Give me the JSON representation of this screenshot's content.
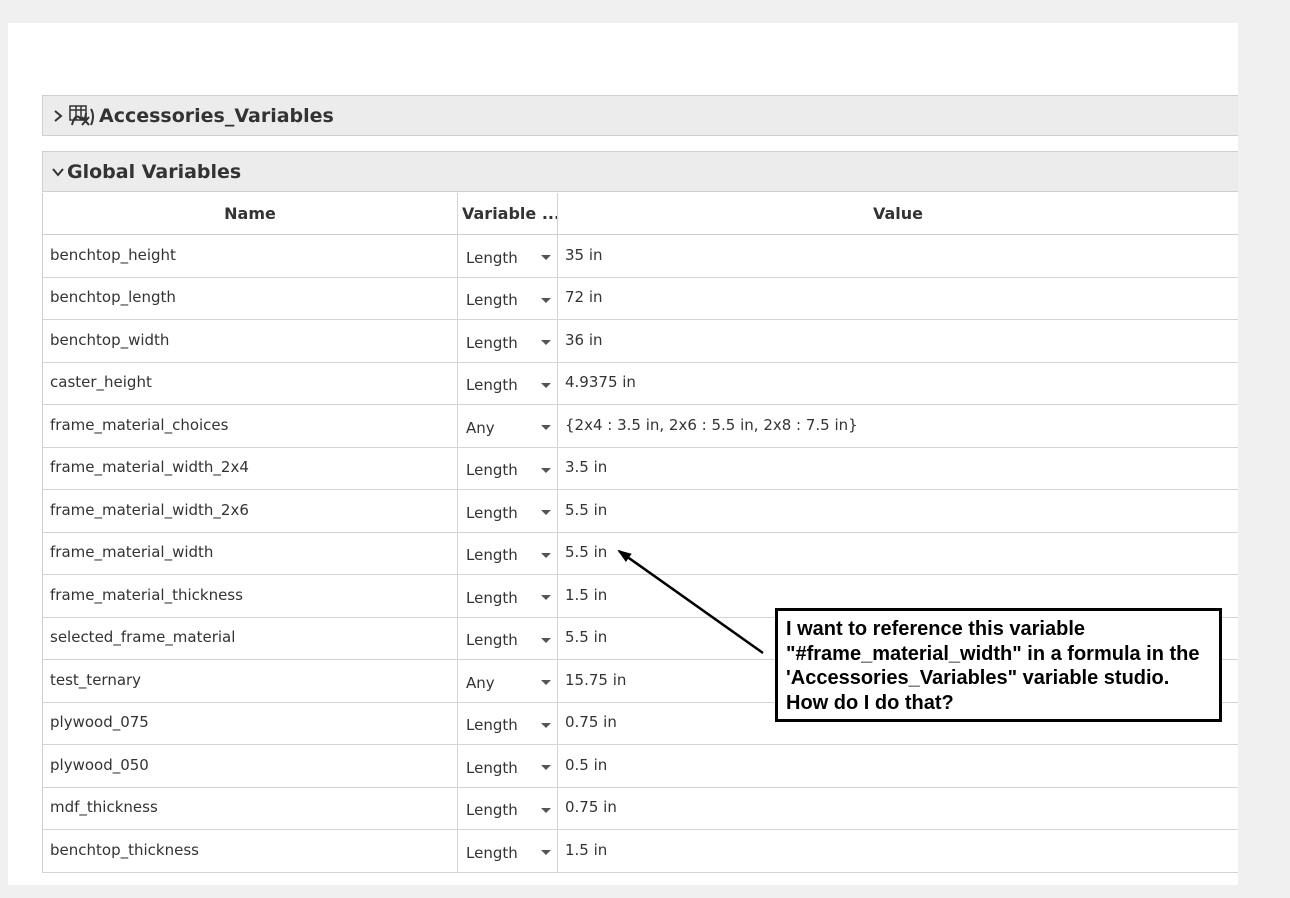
{
  "sections": {
    "accessories": {
      "title": "Accessories_Variables",
      "collapsed": true
    },
    "global": {
      "title": "Global Variables",
      "collapsed": false
    }
  },
  "table": {
    "headers": {
      "name": "Name",
      "type": "Variable ...",
      "value": "Value"
    },
    "rows": [
      {
        "name": "benchtop_height",
        "type": "Length",
        "value": "35 in"
      },
      {
        "name": "benchtop_length",
        "type": "Length",
        "value": "72 in"
      },
      {
        "name": "benchtop_width",
        "type": "Length",
        "value": "36 in"
      },
      {
        "name": "caster_height",
        "type": "Length",
        "value": "4.9375 in"
      },
      {
        "name": "frame_material_choices",
        "type": "Any",
        "value": "{2x4 : 3.5 in, 2x6 : 5.5 in, 2x8 : 7.5 in}"
      },
      {
        "name": "frame_material_width_2x4",
        "type": "Length",
        "value": "3.5 in"
      },
      {
        "name": "frame_material_width_2x6",
        "type": "Length",
        "value": "5.5 in"
      },
      {
        "name": "frame_material_width",
        "type": "Length",
        "value": "5.5 in"
      },
      {
        "name": "frame_material_thickness",
        "type": "Length",
        "value": "1.5 in"
      },
      {
        "name": "selected_frame_material",
        "type": "Length",
        "value": "5.5 in"
      },
      {
        "name": "test_ternary",
        "type": "Any",
        "value": "15.75 in"
      },
      {
        "name": "plywood_075",
        "type": "Length",
        "value": "0.75 in"
      },
      {
        "name": "plywood_050",
        "type": "Length",
        "value": "0.5 in"
      },
      {
        "name": "mdf_thickness",
        "type": "Length",
        "value": "0.75 in"
      },
      {
        "name": "benchtop_thickness",
        "type": "Length",
        "value": "1.5 in"
      }
    ]
  },
  "annotation": {
    "text": "I want to reference this variable \"#frame_material_width\" in a formula in the 'Accessories_Variables\" variable studio.  How do I do that?"
  },
  "icons": {
    "expand": "chevron-right-icon",
    "collapse": "chevron-down-icon",
    "studio": "variable-studio-icon",
    "dropdown": "caret-down-icon"
  },
  "colors": {
    "header_bg": "#ececec",
    "border": "#cfcfcf",
    "text": "#333333",
    "annotation_border": "#000000"
  }
}
